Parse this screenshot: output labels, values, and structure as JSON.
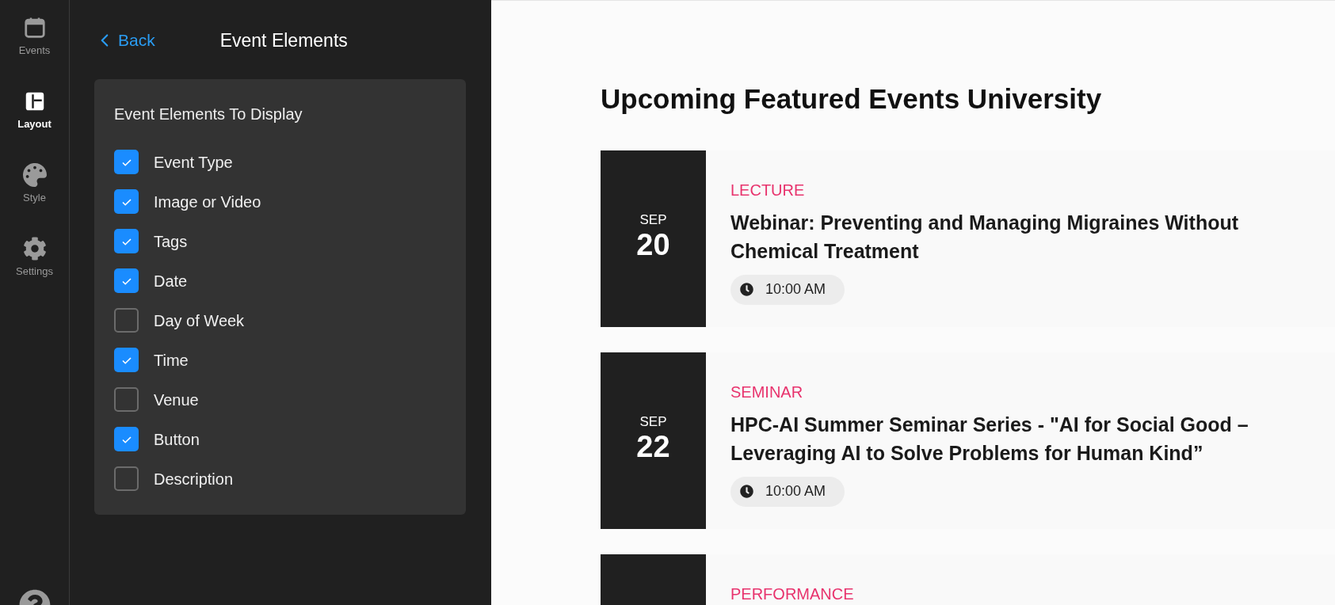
{
  "nav": [
    {
      "label": "Events",
      "kind": "calendar",
      "selected": false
    },
    {
      "label": "Layout",
      "kind": "layout",
      "selected": true
    },
    {
      "label": "Style",
      "kind": "palette",
      "selected": false
    },
    {
      "label": "Settings",
      "kind": "gear",
      "selected": false
    }
  ],
  "panel": {
    "back": "Back",
    "title": "Event Elements",
    "section_title": "Event Elements To Display",
    "options": [
      {
        "label": "Event Type",
        "checked": true
      },
      {
        "label": "Image or Video",
        "checked": true
      },
      {
        "label": "Tags",
        "checked": true
      },
      {
        "label": "Date",
        "checked": true
      },
      {
        "label": "Day of Week",
        "checked": false
      },
      {
        "label": "Time",
        "checked": true
      },
      {
        "label": "Venue",
        "checked": false
      },
      {
        "label": "Button",
        "checked": true
      },
      {
        "label": "Description",
        "checked": false
      }
    ]
  },
  "preview": {
    "heading": "Upcoming Featured Events University",
    "events": [
      {
        "month": "SEP",
        "day": "20",
        "type": "LECTURE",
        "title": "Webinar: Preventing and Managing Migraines Without Chemical Treatment",
        "time": "10:00 AM"
      },
      {
        "month": "SEP",
        "day": "22",
        "type": "SEMINAR",
        "title": "HPC-AI Summer Seminar Series - \"AI for Social Good – Leveraging AI to Solve Problems for Human Kind”",
        "time": "10:00 AM"
      },
      {
        "type": "PERFORMANCE"
      }
    ]
  }
}
